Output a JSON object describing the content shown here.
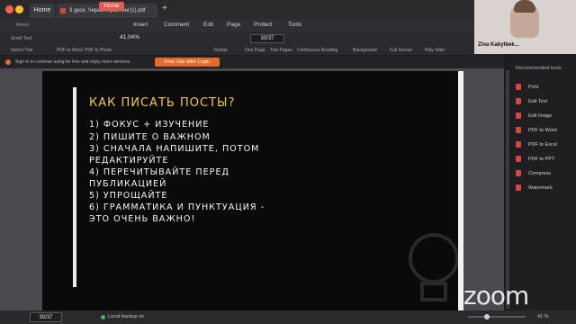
{
  "tabs": {
    "home": "Home",
    "document": "3 урок. Чирак...ирайтинг(1).pdf"
  },
  "menu": {
    "items": [
      "Menu",
      "Home",
      "Insert",
      "Comment",
      "Edit",
      "Page",
      "Protect",
      "Tools"
    ]
  },
  "toolbar": {
    "labels": [
      "Scroll Tool",
      "Select Tool",
      "PDF to Word",
      "PDF to Photo",
      "Rotate",
      "One Page",
      "Two Pages",
      "Continuous Reading",
      "Background",
      "Full Screen",
      "Play Slide"
    ],
    "zoom": "41.04%",
    "page": "30/37"
  },
  "notice": {
    "text": "Sign in to continue using for free and enjoy more services.",
    "button": "Free Use after Login"
  },
  "slide": {
    "title": "КАК ПИСАТЬ ПОСТЫ?",
    "lines": [
      "1) ФОКУС + ИЗУЧЕНИЕ",
      "2) ПИШИТЕ О ВАЖНОМ",
      "3) СНАЧАЛА НАПИШИТЕ, ПОТОМ",
      "РЕДАКТИРУЙТЕ",
      "4) ПЕРЕЧИТЫВАЙТЕ ПЕРЕД",
      "ПУБЛИКАЦИЕЙ",
      "5) УПРОЩАЙТЕ",
      "6) ГРАММАТИКА И ПУНКТУАЦИЯ -",
      "ЭТО ОЧЕНЬ ВАЖНО!"
    ]
  },
  "right_panel": {
    "title": "Recommended tools",
    "items": [
      "Print",
      "Edit Text",
      "Edit Image",
      "PDF to Word",
      "PDF to Excel",
      "PDF to PPT",
      "Compress",
      "Watermark"
    ]
  },
  "camera": {
    "name": "Zina Kabylbek..."
  },
  "status": {
    "page": "30/37",
    "backup": "Local backup on",
    "zoom": "41 %"
  },
  "zoom_logo": "zoom",
  "colors": {
    "accent": "#e05a4e",
    "title": "#f2c84b",
    "notice_button": "#e86a2b"
  }
}
